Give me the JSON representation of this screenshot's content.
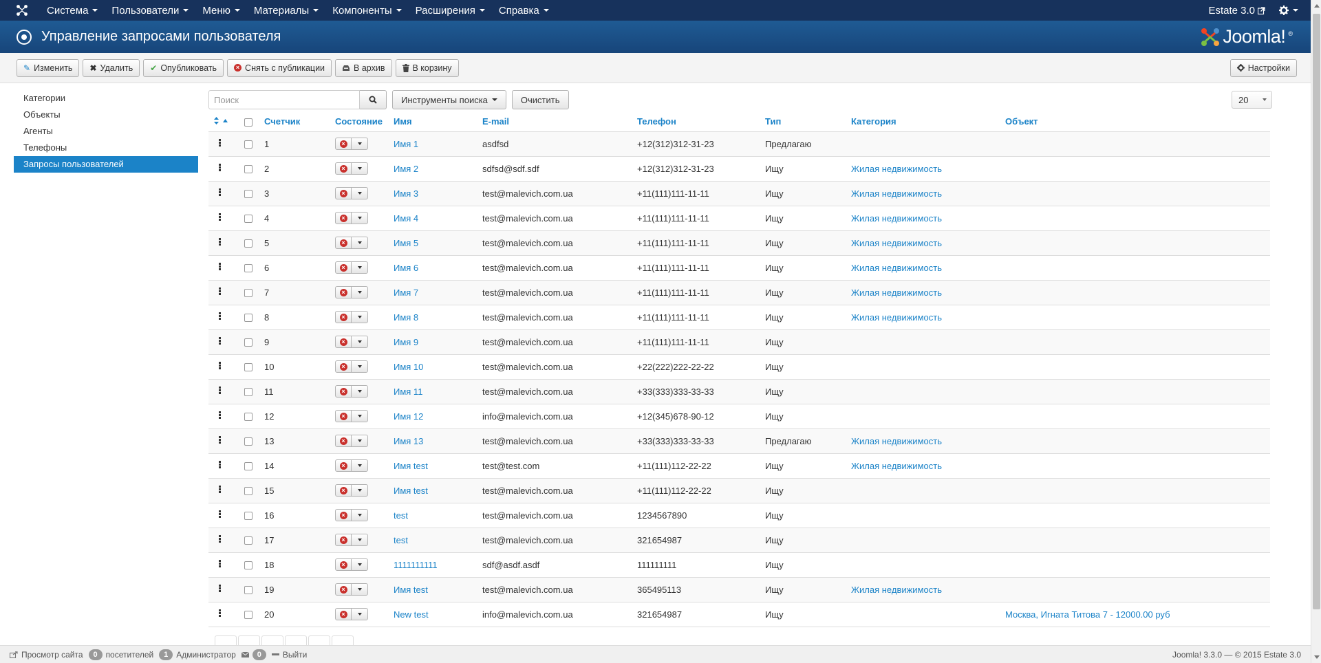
{
  "navbar": {
    "menu": [
      {
        "label": "Система"
      },
      {
        "label": "Пользователи"
      },
      {
        "label": "Меню"
      },
      {
        "label": "Материалы"
      },
      {
        "label": "Компоненты"
      },
      {
        "label": "Расширения"
      },
      {
        "label": "Справка"
      }
    ],
    "site_name": "Estate 3.0"
  },
  "header": {
    "title": "Управление запросами пользователя",
    "logo_text": "Joomla!",
    "logo_mark": "®"
  },
  "toolbar": {
    "edit": "Изменить",
    "delete": "Удалить",
    "publish": "Опубликовать",
    "unpublish": "Снять с публикации",
    "archive": "В архив",
    "trash": "В корзину",
    "options": "Настройки"
  },
  "sidebar": {
    "items": [
      {
        "label": "Категории",
        "active": false
      },
      {
        "label": "Объекты",
        "active": false
      },
      {
        "label": "Агенты",
        "active": false
      },
      {
        "label": "Телефоны",
        "active": false
      },
      {
        "label": "Запросы пользователей",
        "active": true
      }
    ]
  },
  "filters": {
    "search_placeholder": "Поиск",
    "search_tools": "Инструменты поиска",
    "clear": "Очистить",
    "limit": "20"
  },
  "table": {
    "columns": {
      "counter": "Счетчик",
      "state": "Состояние",
      "name": "Имя",
      "email": "E-mail",
      "phone": "Телефон",
      "type": "Тип",
      "category": "Категория",
      "object": "Объект"
    },
    "rows": [
      {
        "counter": "1",
        "name": "Имя 1",
        "email": "asdfsd",
        "phone": "+12(312)312-31-23",
        "type": "Предлагаю",
        "category": "",
        "object": ""
      },
      {
        "counter": "2",
        "name": "Имя 2",
        "email": "sdfsd@sdf.sdf",
        "phone": "+12(312)312-31-23",
        "type": "Ищу",
        "category": "Жилая недвижимость",
        "object": ""
      },
      {
        "counter": "3",
        "name": "Имя 3",
        "email": "test@malevich.com.ua",
        "phone": "+11(111)111-11-11",
        "type": "Ищу",
        "category": "Жилая недвижимость",
        "object": ""
      },
      {
        "counter": "4",
        "name": "Имя 4",
        "email": "test@malevich.com.ua",
        "phone": "+11(111)111-11-11",
        "type": "Ищу",
        "category": "Жилая недвижимость",
        "object": ""
      },
      {
        "counter": "5",
        "name": "Имя 5",
        "email": "test@malevich.com.ua",
        "phone": "+11(111)111-11-11",
        "type": "Ищу",
        "category": "Жилая недвижимость",
        "object": ""
      },
      {
        "counter": "6",
        "name": "Имя 6",
        "email": "test@malevich.com.ua",
        "phone": "+11(111)111-11-11",
        "type": "Ищу",
        "category": "Жилая недвижимость",
        "object": ""
      },
      {
        "counter": "7",
        "name": "Имя 7",
        "email": "test@malevich.com.ua",
        "phone": "+11(111)111-11-11",
        "type": "Ищу",
        "category": "Жилая недвижимость",
        "object": ""
      },
      {
        "counter": "8",
        "name": "Имя 8",
        "email": "test@malevich.com.ua",
        "phone": "+11(111)111-11-11",
        "type": "Ищу",
        "category": "Жилая недвижимость",
        "object": ""
      },
      {
        "counter": "9",
        "name": "Имя 9",
        "email": "test@malevich.com.ua",
        "phone": "+11(111)111-11-11",
        "type": "Ищу",
        "category": "",
        "object": ""
      },
      {
        "counter": "10",
        "name": "Имя 10",
        "email": "test@malevich.com.ua",
        "phone": "+22(222)222-22-22",
        "type": "Ищу",
        "category": "",
        "object": ""
      },
      {
        "counter": "11",
        "name": "Имя 11",
        "email": "test@malevich.com.ua",
        "phone": "+33(333)333-33-33",
        "type": "Ищу",
        "category": "",
        "object": ""
      },
      {
        "counter": "12",
        "name": "Имя 12",
        "email": "info@malevich.com.ua",
        "phone": "+12(345)678-90-12",
        "type": "Ищу",
        "category": "",
        "object": ""
      },
      {
        "counter": "13",
        "name": "Имя 13",
        "email": "test@malevich.com.ua",
        "phone": "+33(333)333-33-33",
        "type": "Предлагаю",
        "category": "Жилая недвижимость",
        "object": ""
      },
      {
        "counter": "14",
        "name": "Имя test",
        "email": "test@test.com",
        "phone": "+11(111)112-22-22",
        "type": "Ищу",
        "category": "Жилая недвижимость",
        "object": ""
      },
      {
        "counter": "15",
        "name": "Имя test",
        "email": "test@malevich.com.ua",
        "phone": "+11(111)112-22-22",
        "type": "Ищу",
        "category": "",
        "object": ""
      },
      {
        "counter": "16",
        "name": "test",
        "email": "test@malevich.com.ua",
        "phone": "1234567890",
        "type": "Ищу",
        "category": "",
        "object": ""
      },
      {
        "counter": "17",
        "name": "test",
        "email": "test@malevich.com.ua",
        "phone": "321654987",
        "type": "Ищу",
        "category": "",
        "object": ""
      },
      {
        "counter": "18",
        "name": "1111111111",
        "email": "sdf@asdf.asdf",
        "phone": "111111111",
        "type": "Ищу",
        "category": "",
        "object": ""
      },
      {
        "counter": "19",
        "name": "Имя test",
        "email": "test@malevich.com.ua",
        "phone": "365495113",
        "type": "Ищу",
        "category": "Жилая недвижимость",
        "object": ""
      },
      {
        "counter": "20",
        "name": "New test",
        "email": "info@malevich.com.ua",
        "phone": "321654987",
        "type": "Ищу",
        "category": "",
        "object": "Москва, Игната Титова 7 - 12000.00 руб"
      }
    ]
  },
  "statusbar": {
    "view_site": "Просмотр сайта",
    "visitors_count": "0",
    "visitors_label": "посетителей",
    "admins_count": "1",
    "admins_label": "Администратор",
    "messages_count": "0",
    "logout": "Выйти",
    "version": "Joomla! 3.3.0 — © 2015 Estate 3.0"
  },
  "colors": {
    "navbar": "#17325c",
    "header": "#1b4f88",
    "accent": "#1b83c8",
    "unpublished": "#c9302c"
  }
}
